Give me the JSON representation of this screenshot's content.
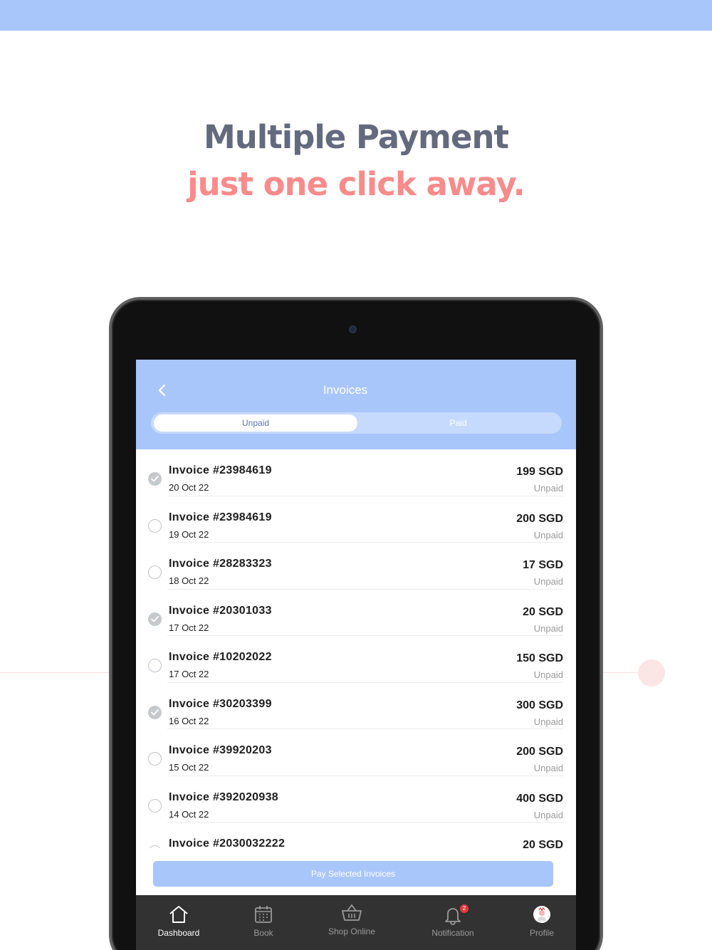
{
  "marketing": {
    "headline_line1": "Multiple Payment",
    "headline_line2": "just one click away."
  },
  "colors": {
    "accent": "#a9c6fb",
    "headline_gray": "#646a7e",
    "headline_coral": "#f98b8b",
    "badge_red": "#e0393e"
  },
  "app": {
    "title": "Invoices",
    "tabs": [
      {
        "label": "Unpaid",
        "active": true
      },
      {
        "label": "Paid",
        "active": false
      }
    ],
    "invoices": [
      {
        "title": "Invoice #23984619",
        "date": "20 Oct 22",
        "amount": "199 SGD",
        "status": "Unpaid",
        "selected": true
      },
      {
        "title": "Invoice #23984619",
        "date": "19 Oct 22",
        "amount": "200 SGD",
        "status": "Unpaid",
        "selected": false
      },
      {
        "title": "Invoice #28283323",
        "date": "18 Oct 22",
        "amount": "17 SGD",
        "status": "Unpaid",
        "selected": false
      },
      {
        "title": "Invoice #20301033",
        "date": "17 Oct 22",
        "amount": "20 SGD",
        "status": "Unpaid",
        "selected": true
      },
      {
        "title": "Invoice #10202022",
        "date": "17 Oct 22",
        "amount": "150 SGD",
        "status": "Unpaid",
        "selected": false
      },
      {
        "title": "Invoice #30203399",
        "date": "16 Oct 22",
        "amount": "300 SGD",
        "status": "Unpaid",
        "selected": true
      },
      {
        "title": "Invoice #39920203",
        "date": "15 Oct 22",
        "amount": "200 SGD",
        "status": "Unpaid",
        "selected": false
      },
      {
        "title": "Invoice #392020938",
        "date": "14 Oct 22",
        "amount": "400 SGD",
        "status": "Unpaid",
        "selected": false
      },
      {
        "title": "Invoice #2030032222",
        "date": "",
        "amount": "20 SGD",
        "status": "",
        "selected": false
      }
    ],
    "pay_button": "Pay Selected Invoices",
    "nav": [
      {
        "label": "Dashboard",
        "icon": "home-icon",
        "active": true
      },
      {
        "label": "Book",
        "icon": "calendar-icon",
        "active": false
      },
      {
        "label": "Shop Online",
        "icon": "basket-icon",
        "active": false
      },
      {
        "label": "Notification",
        "icon": "bell-icon",
        "active": false,
        "badge": "2"
      },
      {
        "label": "Profile",
        "icon": "avatar-icon",
        "active": false
      }
    ]
  }
}
